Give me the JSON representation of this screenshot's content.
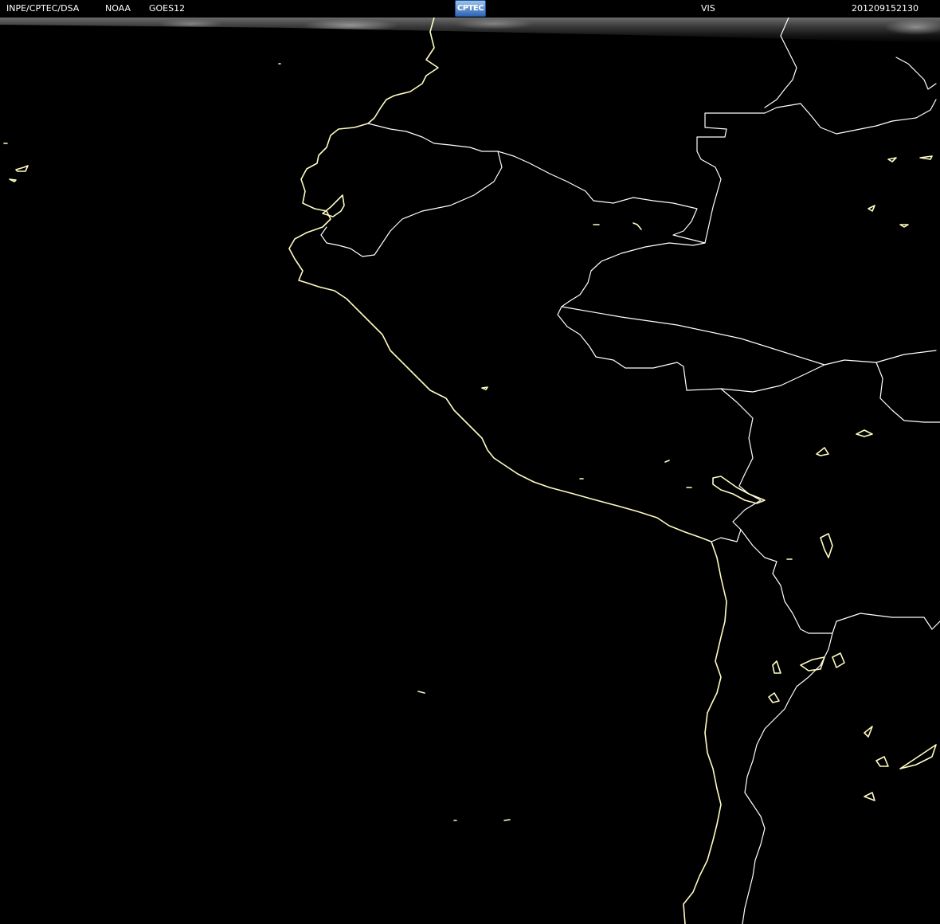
{
  "header": {
    "agency": "INPE/CPTEC/DSA",
    "source": "NOAA",
    "satellite": "GOES12",
    "logo_text": "CPTEC",
    "channel": "VIS",
    "timestamp": "201209152130"
  },
  "colors": {
    "background": "#000000",
    "coastline": "#fffcc2",
    "border": "#ffffff",
    "header_text": "#ffffff"
  },
  "icons": {
    "logo": "cptec-logo-icon"
  }
}
